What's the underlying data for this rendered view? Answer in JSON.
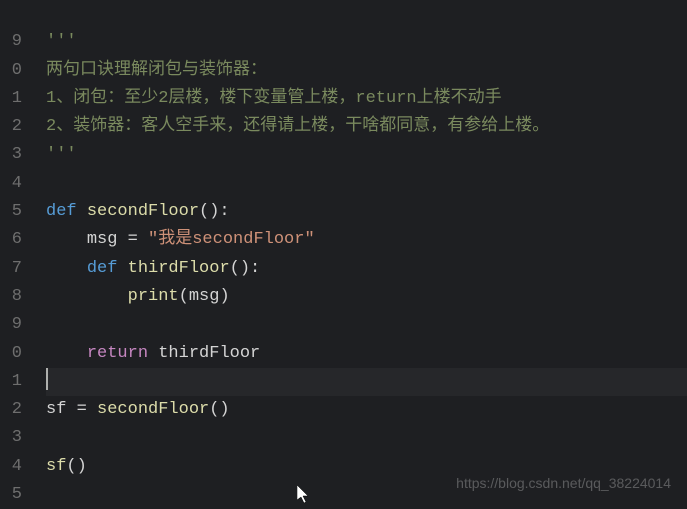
{
  "gutter": {
    "lines": [
      "",
      "9",
      "0",
      "1",
      "2",
      "3",
      "4",
      "5",
      "6",
      "7",
      "8",
      "9",
      "0",
      "1",
      "2",
      "3",
      "4",
      "5"
    ]
  },
  "code": {
    "l1": "",
    "l2_comment": "'''",
    "l3_comment": "两句口诀理解闭包与装饰器：",
    "l4_comment": "1、闭包：至少2层楼，楼下变量管上楼，return上楼不动手",
    "l5_comment": "2、装饰器：客人空手来，还得请上楼，干啥都同意，有参给上楼。",
    "l6_comment": "'''",
    "l7": "",
    "l8_def": "def",
    "l8_name": "secondFloor",
    "l8_paren": "():",
    "l9_var": "msg",
    "l9_eq": " = ",
    "l9_str": "\"我是secondFloor\"",
    "l10_def": "def",
    "l10_name": "thirdFloor",
    "l10_paren": "():",
    "l11_builtin": "print",
    "l11_open": "(",
    "l11_arg": "msg",
    "l11_close": ")",
    "l12": "",
    "l13_return": "return",
    "l13_val": " thirdFloor",
    "l14": "",
    "l15_var": "sf",
    "l15_eq": " = ",
    "l15_call": "secondFloor",
    "l15_paren": "()",
    "l16": "",
    "l17_call": "sf",
    "l17_paren": "()"
  },
  "watermark": "https://blog.csdn.net/qq_38224014",
  "colors": {
    "background": "#1e1f22",
    "keyword": "#569cd6",
    "string": "#ce9178",
    "comment": "#7a8a5e",
    "function": "#dcdcaa",
    "return": "#c586c0"
  }
}
